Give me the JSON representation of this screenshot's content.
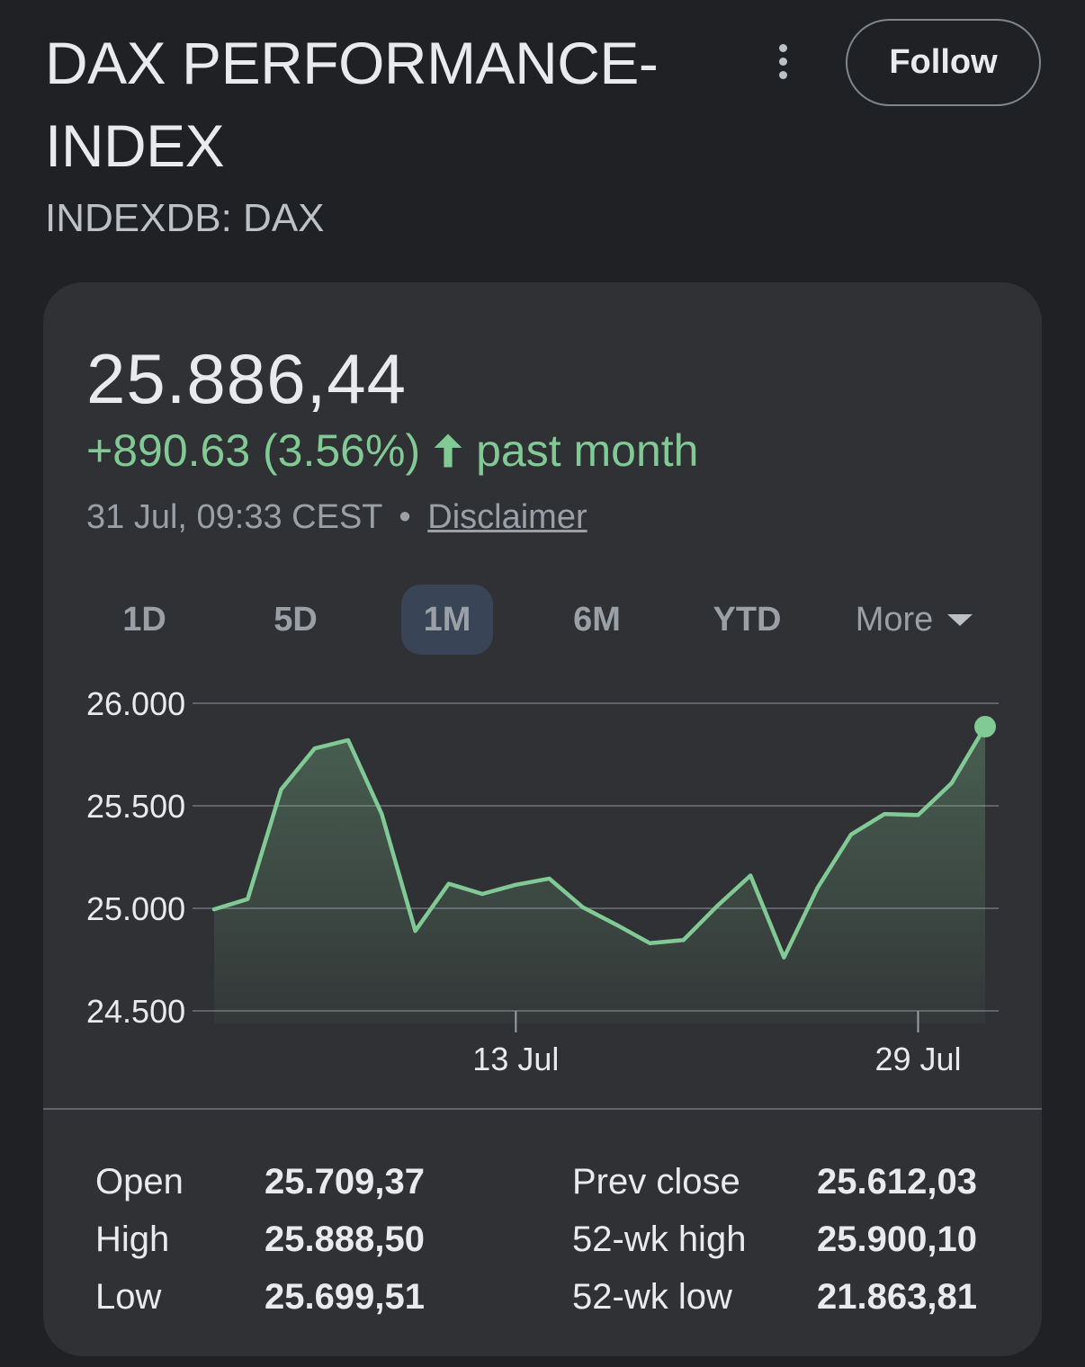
{
  "header": {
    "title_line1": "DAX PERFORMANCE-",
    "title_line2": "INDEX",
    "ticker": "INDEXDB: DAX",
    "follow_label": "Follow"
  },
  "quote": {
    "price": "25.886,44",
    "change": "+890.63 (3.56%)",
    "period": "past month",
    "timestamp": "31 Jul, 09:33 CEST",
    "separator": "•",
    "disclaimer": "Disclaimer",
    "positive_color": "#81c995"
  },
  "tabs": [
    {
      "label": "1D",
      "active": false
    },
    {
      "label": "5D",
      "active": false
    },
    {
      "label": "1M",
      "active": true
    },
    {
      "label": "6M",
      "active": false
    },
    {
      "label": "YTD",
      "active": false
    },
    {
      "label": "More",
      "active": false
    }
  ],
  "chart_data": {
    "type": "area",
    "x": [
      "1 Jul",
      "2 Jul",
      "3 Jul",
      "4 Jul",
      "7 Jul",
      "8 Jul",
      "9 Jul",
      "10 Jul",
      "11 Jul",
      "14 Jul",
      "15 Jul",
      "16 Jul",
      "17 Jul",
      "18 Jul",
      "21 Jul",
      "22 Jul",
      "23 Jul",
      "24 Jul",
      "25 Jul",
      "28 Jul",
      "29 Jul",
      "30 Jul",
      "31 Jul"
    ],
    "values": [
      24995,
      25045,
      25580,
      25780,
      25820,
      25460,
      24890,
      25120,
      25070,
      25115,
      25145,
      25005,
      24920,
      24830,
      24845,
      25010,
      25160,
      24760,
      25100,
      25360,
      25460,
      25455,
      25610,
      25886
    ],
    "ylim": [
      24500,
      26000
    ],
    "yticks": [
      "26.000",
      "25.500",
      "25.000",
      "24.500"
    ],
    "ytick_values": [
      26000,
      25500,
      25000,
      24500
    ],
    "xticks": [
      {
        "label": "13 Jul",
        "index": 9
      },
      {
        "label": "29 Jul",
        "index": 21
      }
    ],
    "grid": true,
    "line_color": "#81c995"
  },
  "stats": {
    "left": [
      {
        "label": "Open",
        "value": "25.709,37"
      },
      {
        "label": "High",
        "value": "25.888,50"
      },
      {
        "label": "Low",
        "value": "25.699,51"
      }
    ],
    "right": [
      {
        "label": "Prev close",
        "value": "25.612,03"
      },
      {
        "label": "52-wk high",
        "value": "25.900,10"
      },
      {
        "label": "52-wk low",
        "value": "21.863,81"
      }
    ]
  }
}
